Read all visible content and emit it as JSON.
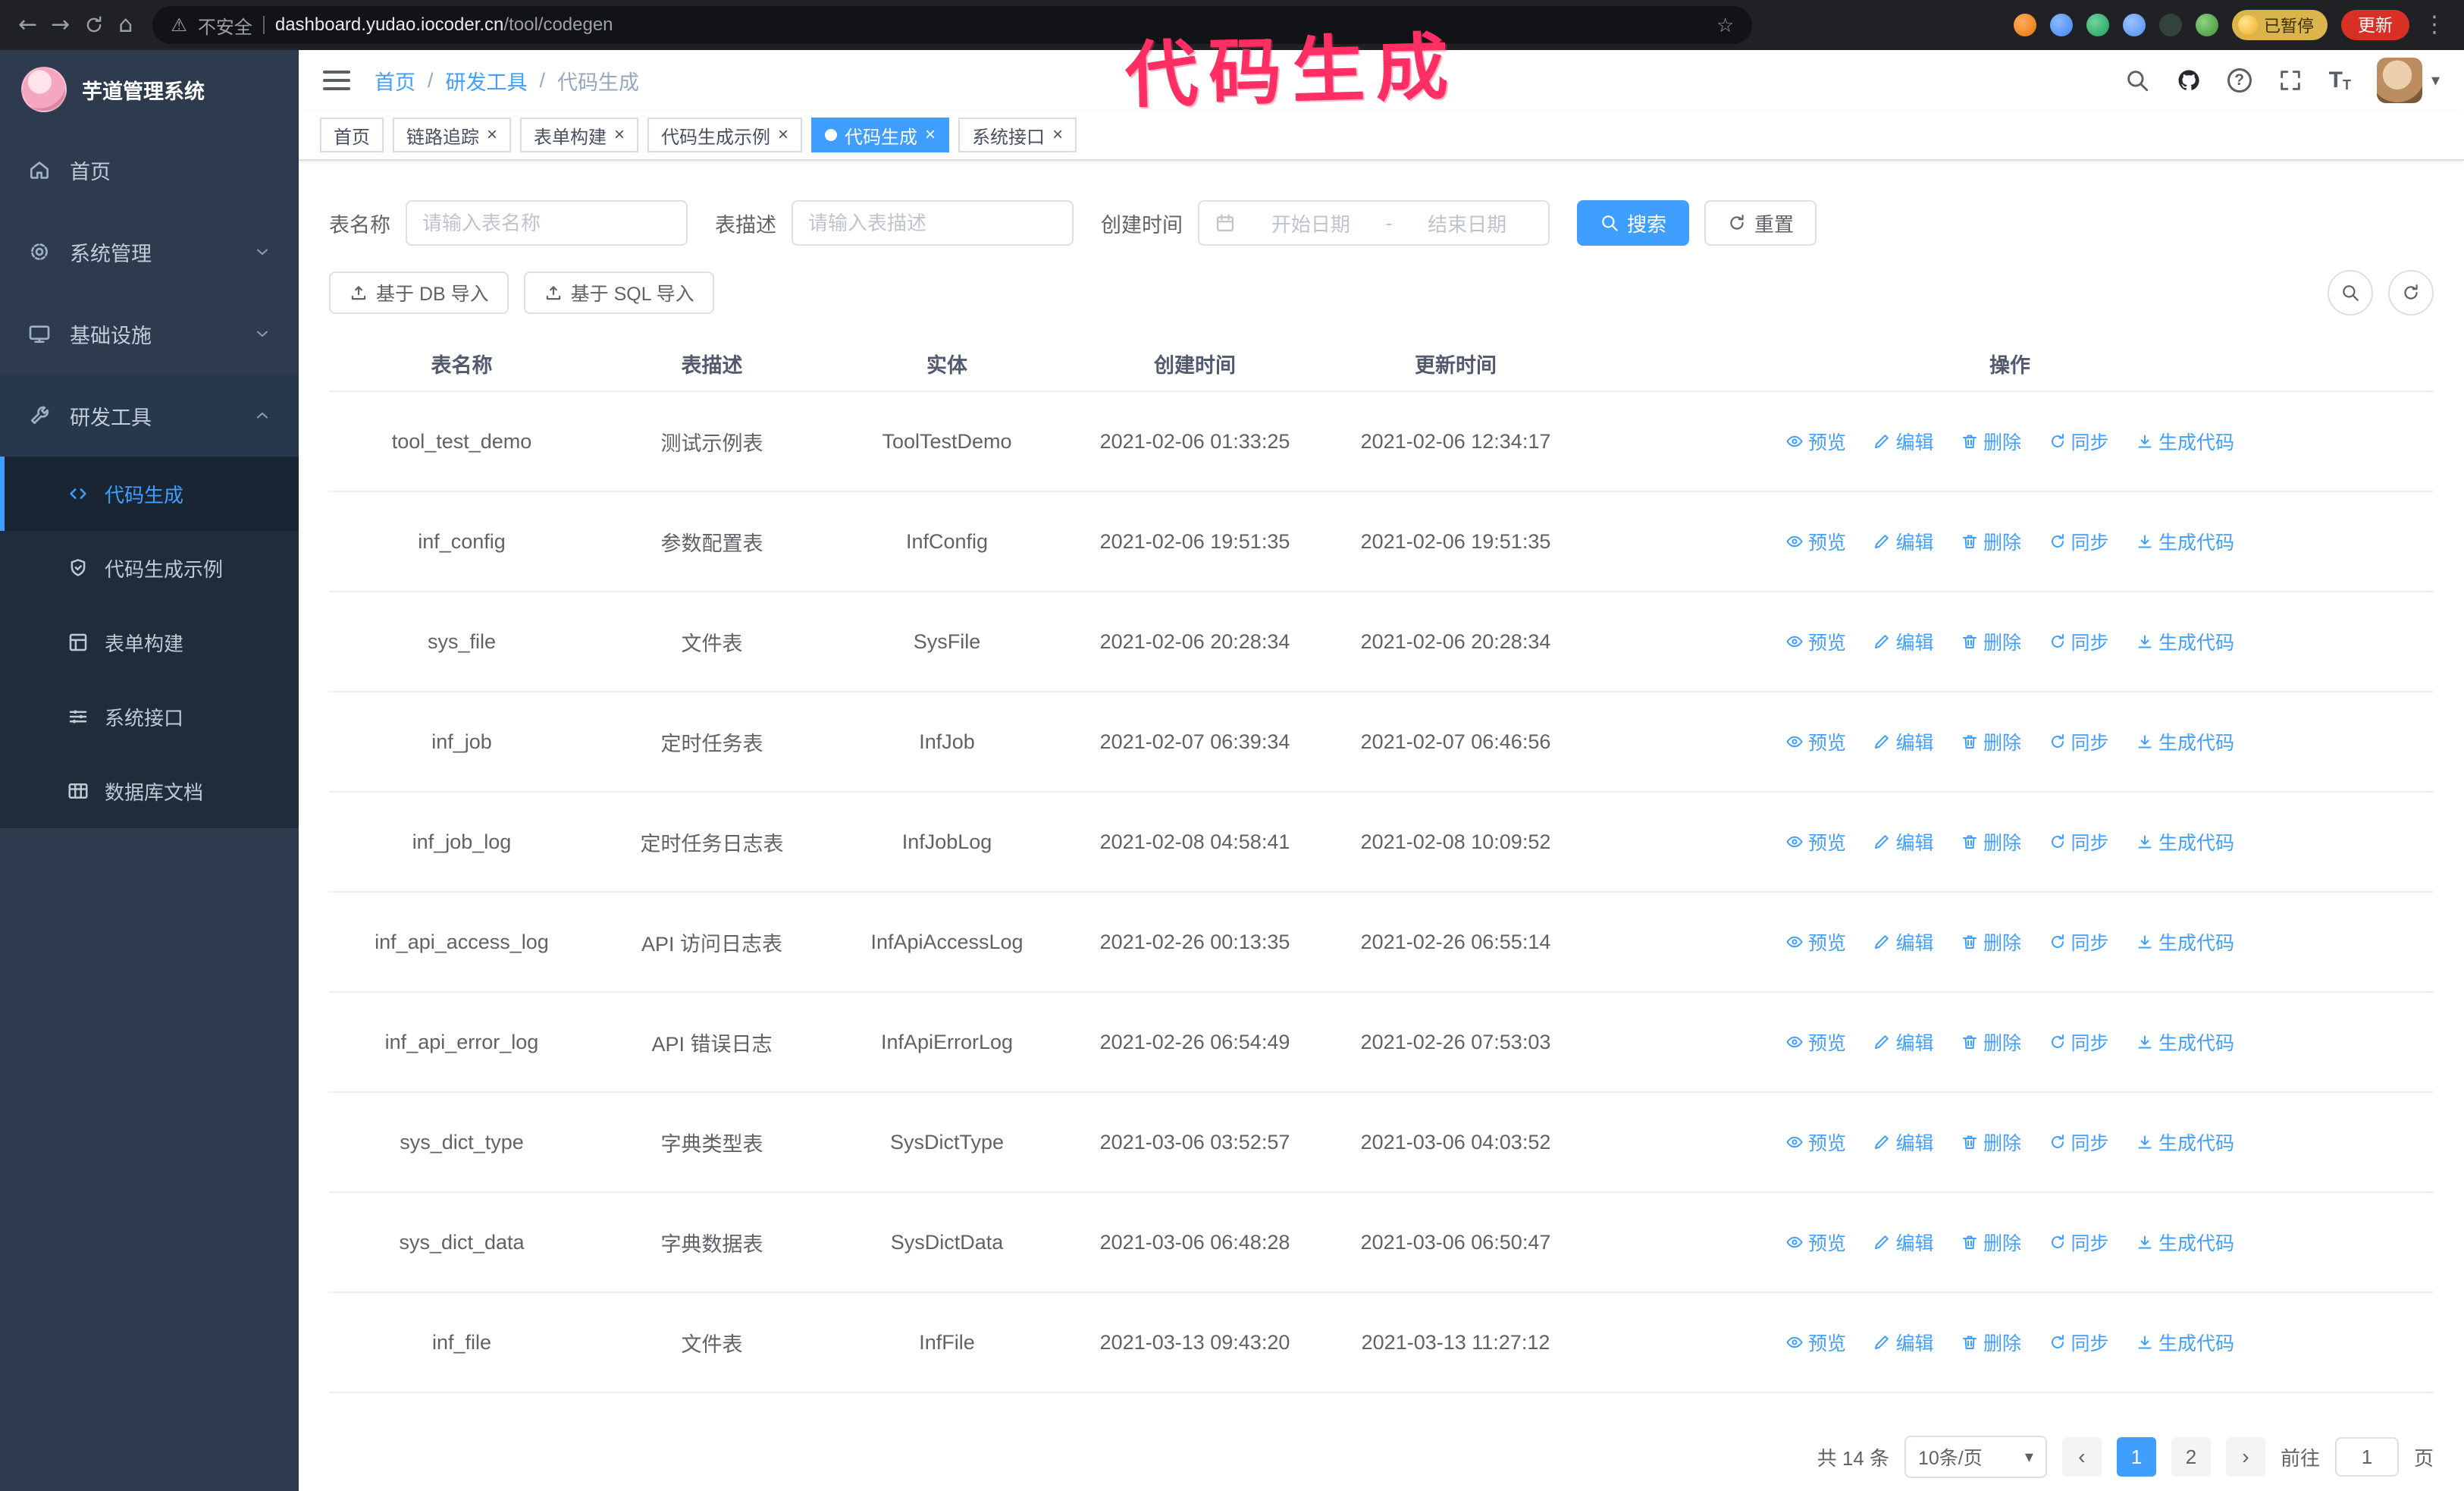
{
  "colors": {
    "primary": "#409eff",
    "annotation": "#ff2e63",
    "sidebar_bg": "#2e3b4e"
  },
  "icons": {
    "back": "←",
    "forward": "→",
    "home": "⌂",
    "warning": "⚠",
    "star": "☆",
    "kebab": "⋮",
    "caret_down": "▾",
    "close": "×",
    "prev": "‹",
    "next": "›",
    "question": "?",
    "font_large": "T",
    "font_small": "T",
    "separator": "/"
  },
  "browser": {
    "security_text": "不安全",
    "url_domain": "dashboard.yudao.iocoder.cn",
    "url_path": "/tool/codegen",
    "paused_badge": "已暂停",
    "update_button": "更新"
  },
  "annotation": {
    "text": "代码生成"
  },
  "sidebar": {
    "logo_title": "芋道管理系统",
    "menu": [
      {
        "label": "首页"
      },
      {
        "label": "系统管理"
      },
      {
        "label": "基础设施"
      },
      {
        "label": "研发工具"
      }
    ],
    "submenu": [
      {
        "label": "代码生成"
      },
      {
        "label": "代码生成示例"
      },
      {
        "label": "表单构建"
      },
      {
        "label": "系统接口"
      },
      {
        "label": "数据库文档"
      }
    ]
  },
  "header": {
    "breadcrumb": [
      "首页",
      "研发工具",
      "代码生成"
    ]
  },
  "tabs": [
    {
      "label": "首页"
    },
    {
      "label": "链路追踪"
    },
    {
      "label": "表单构建"
    },
    {
      "label": "代码生成示例"
    },
    {
      "label": "代码生成"
    },
    {
      "label": "系统接口"
    }
  ],
  "filters": {
    "table_name_label": "表名称",
    "table_name_placeholder": "请输入表名称",
    "table_desc_label": "表描述",
    "table_desc_placeholder": "请输入表描述",
    "create_time_label": "创建时间",
    "date_start_placeholder": "开始日期",
    "date_separator": "-",
    "date_end_placeholder": "结束日期",
    "search_button": "搜索",
    "reset_button": "重置"
  },
  "toolbar": {
    "import_db_button": "基于 DB 导入",
    "import_sql_button": "基于 SQL 导入"
  },
  "table": {
    "columns": [
      "表名称",
      "表描述",
      "实体",
      "创建时间",
      "更新时间",
      "操作"
    ],
    "actions": [
      "预览",
      "编辑",
      "删除",
      "同步",
      "生成代码"
    ],
    "rows": [
      {
        "name": "tool_test_demo",
        "desc": "测试示例表",
        "entity": "ToolTestDemo",
        "created": "2021-02-06 01:33:25",
        "updated": "2021-02-06 12:34:17"
      },
      {
        "name": "inf_config",
        "desc": "参数配置表",
        "entity": "InfConfig",
        "created": "2021-02-06 19:51:35",
        "updated": "2021-02-06 19:51:35"
      },
      {
        "name": "sys_file",
        "desc": "文件表",
        "entity": "SysFile",
        "created": "2021-02-06 20:28:34",
        "updated": "2021-02-06 20:28:34"
      },
      {
        "name": "inf_job",
        "desc": "定时任务表",
        "entity": "InfJob",
        "created": "2021-02-07 06:39:34",
        "updated": "2021-02-07 06:46:56"
      },
      {
        "name": "inf_job_log",
        "desc": "定时任务日志表",
        "entity": "InfJobLog",
        "created": "2021-02-08 04:58:41",
        "updated": "2021-02-08 10:09:52"
      },
      {
        "name": "inf_api_access_log",
        "desc": "API 访问日志表",
        "entity": "InfApiAccessLog",
        "created": "2021-02-26 00:13:35",
        "updated": "2021-02-26 06:55:14"
      },
      {
        "name": "inf_api_error_log",
        "desc": "API 错误日志",
        "entity": "InfApiErrorLog",
        "created": "2021-02-26 06:54:49",
        "updated": "2021-02-26 07:53:03"
      },
      {
        "name": "sys_dict_type",
        "desc": "字典类型表",
        "entity": "SysDictType",
        "created": "2021-03-06 03:52:57",
        "updated": "2021-03-06 04:03:52"
      },
      {
        "name": "sys_dict_data",
        "desc": "字典数据表",
        "entity": "SysDictData",
        "created": "2021-03-06 06:48:28",
        "updated": "2021-03-06 06:50:47"
      },
      {
        "name": "inf_file",
        "desc": "文件表",
        "entity": "InfFile",
        "created": "2021-03-13 09:43:20",
        "updated": "2021-03-13 11:27:12"
      }
    ]
  },
  "pagination": {
    "total_text": "共 14 条",
    "page_size": "10条/页",
    "pages": [
      "1",
      "2"
    ],
    "goto_label": "前往",
    "goto_value": "1",
    "page_suffix": "页"
  }
}
